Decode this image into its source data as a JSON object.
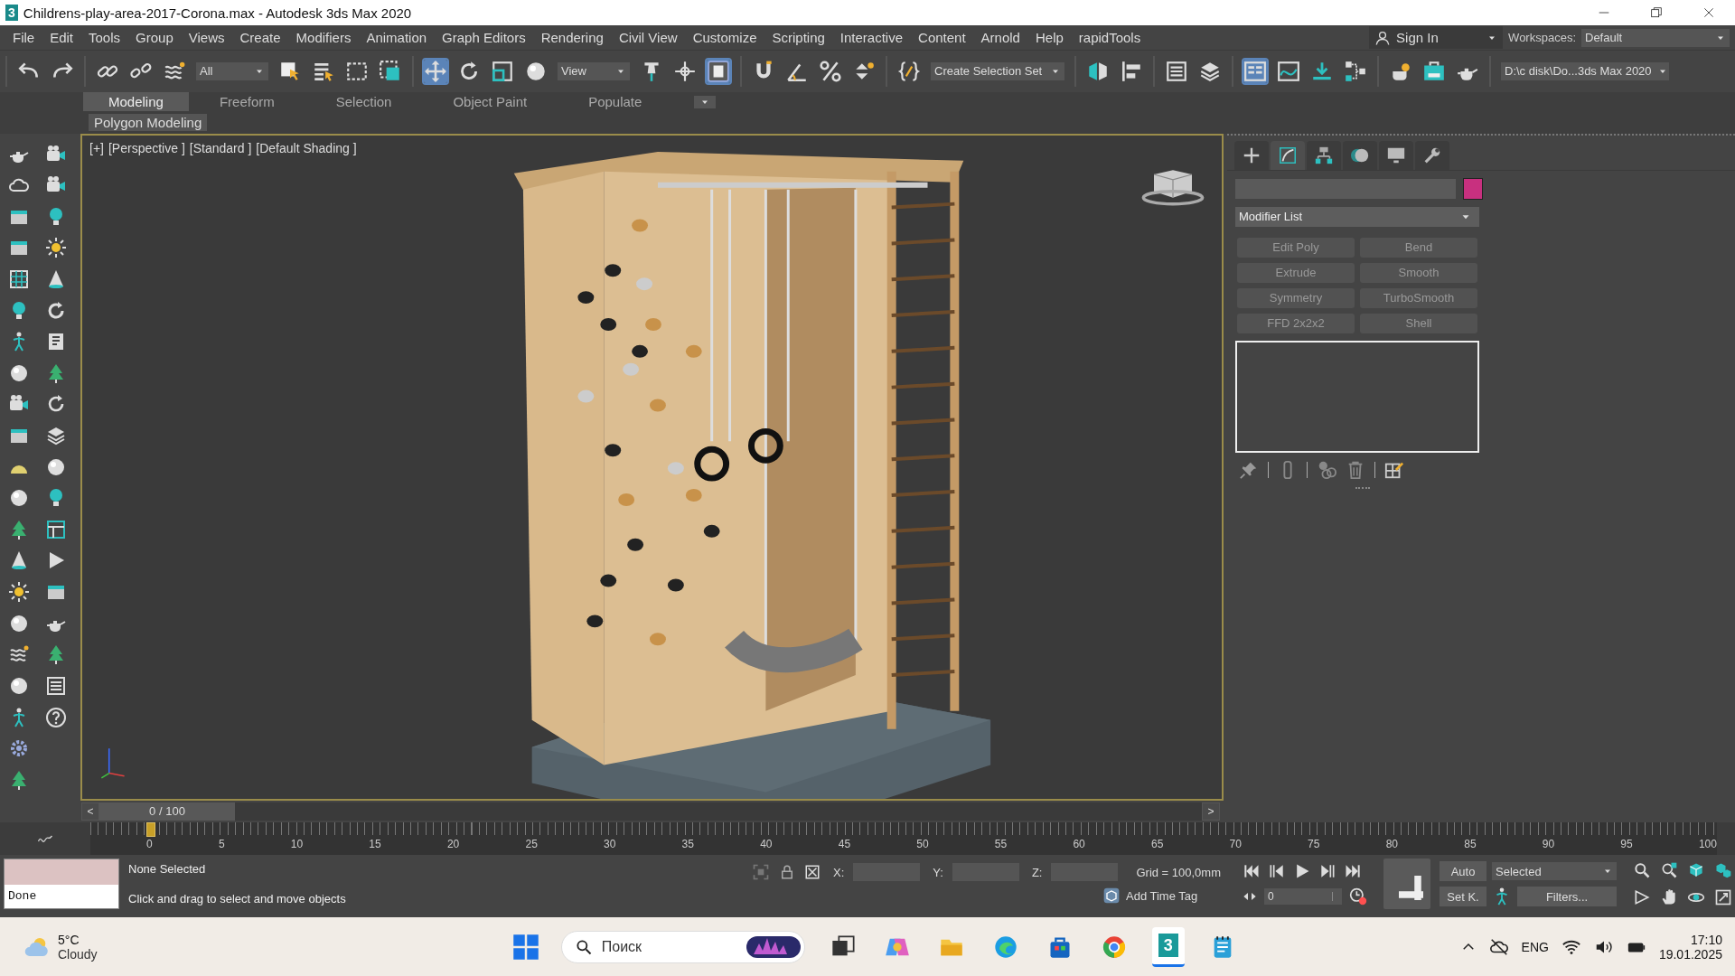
{
  "window": {
    "icon_glyph": "3",
    "title": "Childrens-play-area-2017-Corona.max - Autodesk 3ds Max 2020"
  },
  "menu_bar": {
    "items": [
      "File",
      "Edit",
      "Tools",
      "Group",
      "Views",
      "Create",
      "Modifiers",
      "Animation",
      "Graph Editors",
      "Rendering",
      "Civil View",
      "Customize",
      "Scripting",
      "Interactive",
      "Content",
      "Arnold",
      "Help",
      "rapidTools"
    ],
    "sign_in": "Sign In",
    "workspaces_label": "Workspaces:",
    "workspace": "Default"
  },
  "main_toolbar": {
    "selection_filter": "All",
    "reference_coordinate": "View",
    "named_selection": "Create Selection Set",
    "project_path": "D:\\c disk\\Do...3ds Max 2020"
  },
  "ribbon": {
    "tabs": [
      {
        "label": "Modeling",
        "selected": true
      },
      {
        "label": "Freeform",
        "selected": false
      },
      {
        "label": "Selection",
        "selected": false
      },
      {
        "label": "Object Paint",
        "selected": false
      },
      {
        "label": "Populate",
        "selected": false
      }
    ],
    "panel_label": "Polygon Modeling"
  },
  "viewport": {
    "labels": [
      "[+]",
      "[Perspective ]",
      "[Standard ]",
      "[Default Shading ]"
    ]
  },
  "command_panel": {
    "tabs": [
      {
        "kind": "create",
        "selected": false
      },
      {
        "kind": "modify",
        "selected": true
      },
      {
        "kind": "hierarchy",
        "selected": false
      },
      {
        "kind": "motion",
        "selected": false
      },
      {
        "kind": "display",
        "selected": false
      },
      {
        "kind": "utilities",
        "selected": false
      }
    ],
    "modifier_list": "Modifier List",
    "modifier_buttons": [
      "Edit Poly",
      "Bend",
      "Extrude",
      "Smooth",
      "Symmetry",
      "TurboSmooth",
      "FFD 2x2x2",
      "Shell"
    ]
  },
  "time_slider": {
    "prev": "<",
    "position": "0 / 100",
    "next": ">",
    "level": 0
  },
  "track_bar": {
    "frame_labels": [
      "0",
      "5",
      "10",
      "15",
      "20",
      "25",
      "30",
      "35",
      "40",
      "45",
      "50",
      "55",
      "60",
      "65",
      "70",
      "75",
      "80",
      "85",
      "90",
      "95",
      "100"
    ]
  },
  "status_bar": {
    "listener_output": "Done",
    "selection": "None Selected",
    "prompt": "Click and drag to select and move objects",
    "x_label": "X:",
    "y_label": "Y:",
    "z_label": "Z:",
    "grid": "Grid = 100,0mm",
    "add_time_tag": "Add Time Tag",
    "current_frame": "0",
    "auto_key": "Auto",
    "set_key": "Set K.",
    "key_filter": "Selected",
    "filters": "Filters..."
  },
  "taskbar": {
    "temperature": "5°C",
    "weather": "Cloudy",
    "search_placeholder": "Поиск",
    "max_glyph": "3",
    "language": "ENG",
    "time": "17:10",
    "date": "19.01.2025"
  }
}
